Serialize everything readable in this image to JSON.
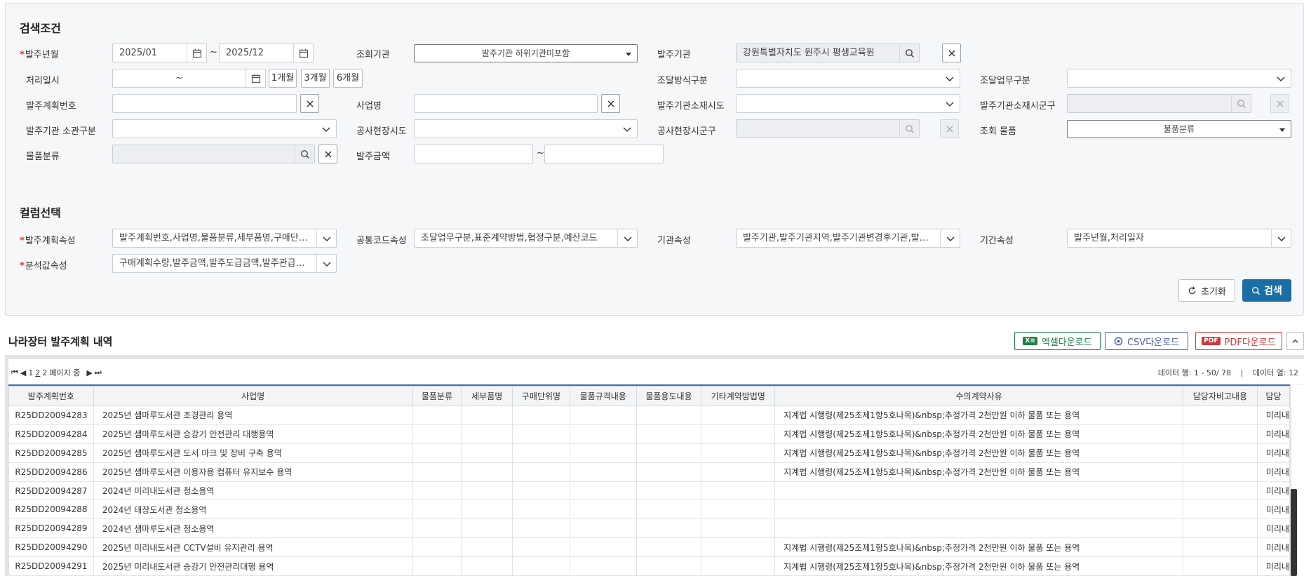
{
  "search": {
    "section_title": "검색조건",
    "labels": {
      "order_month": "발주년월",
      "query_org": "조회기관",
      "order_org": "발주기관",
      "process_date": "처리일시",
      "proc_method": "조달방식구분",
      "proc_work": "조달업무구분",
      "plan_no": "발주계획번호",
      "biz_name": "사업명",
      "org_sido": "발주기관소재시도",
      "org_sigungu": "발주기관소재시군구",
      "org_dept": "발주기관 소관구분",
      "site_sido": "공사현장시도",
      "site_sigungu": "공사현장시군구",
      "query_item": "조회 물품",
      "item_class": "물품분류",
      "order_amount": "발주금액"
    },
    "values": {
      "month_from": "2025/01",
      "month_to": "2025/12",
      "tilde": "~",
      "query_org": "발주기관 하위기관미포함",
      "order_org": "강원특별자치도 원주시 평생교육원",
      "date_range": "~",
      "period_1": "1개월",
      "period_3": "3개월",
      "period_6": "6개월",
      "query_item": "물품분류"
    }
  },
  "columns": {
    "section_title": "컬럼선택",
    "labels": {
      "plan_attr": "발주계획속성",
      "common_code": "공통코드속성",
      "org_attr": "기관속성",
      "period_attr": "기간속성",
      "analysis_attr": "분석값속성"
    },
    "values": {
      "plan_attr": "발주계획번호,사업명,물품분류,세부품명,구매단위명,물품규격내용,물품용도내용",
      "common_code": "조달업무구분,표준계약방법,협정구분,예산코드",
      "org_attr": "발주기관,발주기관지역,발주기관변경후기관,발주기관소관구분",
      "period_attr": "발주년월,처리일자",
      "analysis_attr": "구매계획수량,발주금액,발주도급금액,발주관급금액"
    }
  },
  "actions": {
    "reset": "초기화",
    "search": "검색"
  },
  "list": {
    "title": "나라장터 발주계획 내역",
    "excel": "엑셀다운로드",
    "csv": "CSV다운로드",
    "pdf": "PDF다운로드"
  },
  "pager": {
    "page1": "1",
    "page2": "2",
    "total_pages": "2",
    "suffix": "페이지 중"
  },
  "rowcount": {
    "rows": "데이터 행: 1 - 50/ 78",
    "cols": "데이터 열: 12"
  },
  "grid": {
    "headers": [
      "발주계획번호",
      "사업명",
      "물품분류",
      "세부품명",
      "구매단위명",
      "물품규격내용",
      "물품용도내용",
      "기타계약방법명",
      "수의계약사유",
      "담당자비고내용",
      "담당"
    ],
    "rows": [
      [
        "R25DD20094283",
        "2025년 샘마루도서관 조경관리 용역",
        "지계법 시행령(제25조제1항5호나목)&nbsp;추정가격 2천만원 이하 물품 또는 용역",
        "미리내"
      ],
      [
        "R25DD20094284",
        "2025년 샘마루도서관 승강기 안전관리 대행용역",
        "지계법 시행령(제25조제1항5호나목)&nbsp;추정가격 2천만원 이하 물품 또는 용역",
        "미리내"
      ],
      [
        "R25DD20094285",
        "2025년 샘마루도서관 도서 마크 및 장비 구축 용역",
        "지계법 시행령(제25조제1항5호나목)&nbsp;추정가격 2천만원 이하 물품 또는 용역",
        "미리내"
      ],
      [
        "R25DD20094286",
        "2025년 샘마루도서관 이용자용 컴퓨터 유지보수 용역",
        "지계법 시행령(제25조제1항5호나목)&nbsp;추정가격 2천만원 이하 물품 또는 용역",
        "미리내"
      ],
      [
        "R25DD20094287",
        "2024년 미리내도서관 청소용역",
        "",
        "미리내"
      ],
      [
        "R25DD20094288",
        "2024년 태장도서관 청소용역",
        "",
        "미리내"
      ],
      [
        "R25DD20094289",
        "2024년 샘마루도서관 청소용역",
        "",
        "미리내"
      ],
      [
        "R25DD20094290",
        "2025년 미리내도서관 CCTV설비 유지관리 용역",
        "지계법 시행령(제25조제1항5호나목)&nbsp;추정가격 2천만원 이하 물품 또는 용역",
        "미리내"
      ],
      [
        "R25DD20094291",
        "2025년 미리내도서관 승강기 안전관리대행 용역",
        "지계법 시행령(제25조제1항5호나목)&nbsp;추정가격 2천만원 이하 물품 또는 용역",
        "미리내"
      ]
    ]
  },
  "colors": {
    "primary": "#1b6da6",
    "excel": "#1e7e45",
    "csv": "#4a5fa8",
    "pdf": "#d0393c",
    "required": "#e0312b"
  }
}
